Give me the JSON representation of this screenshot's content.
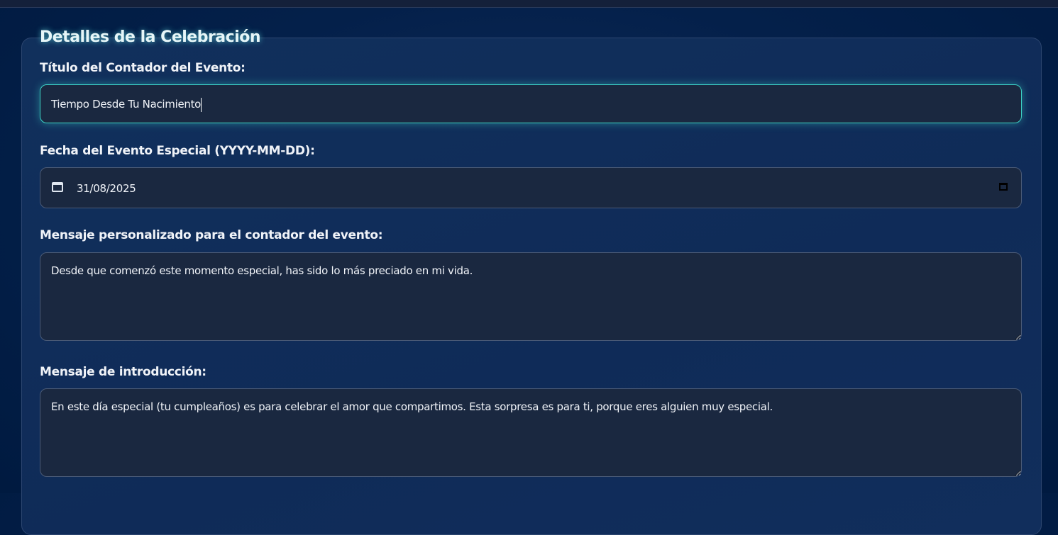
{
  "section_title": "Detalles de la Celebración",
  "fields": {
    "title_label": "Título del Contador del Evento:",
    "title_value": "Tiempo Desde Tu Nacimiento",
    "date_label": "Fecha del Evento Especial (YYYY-MM-DD):",
    "date_value": "31/08/2025",
    "message_label": "Mensaje personalizado para el contador del evento:",
    "message_value": "Desde que comenzó este momento especial, has sido lo más preciado en mi vida.",
    "intro_label": "Mensaje de introducción:",
    "intro_value": "En este día especial (tu cumpleaños) es para celebrar el amor que compartimos. Esta sorpresa es para ti, porque eres alguien muy especial."
  },
  "colors": {
    "accent": "#3cd0c4",
    "field_bg": "#1a2840"
  }
}
